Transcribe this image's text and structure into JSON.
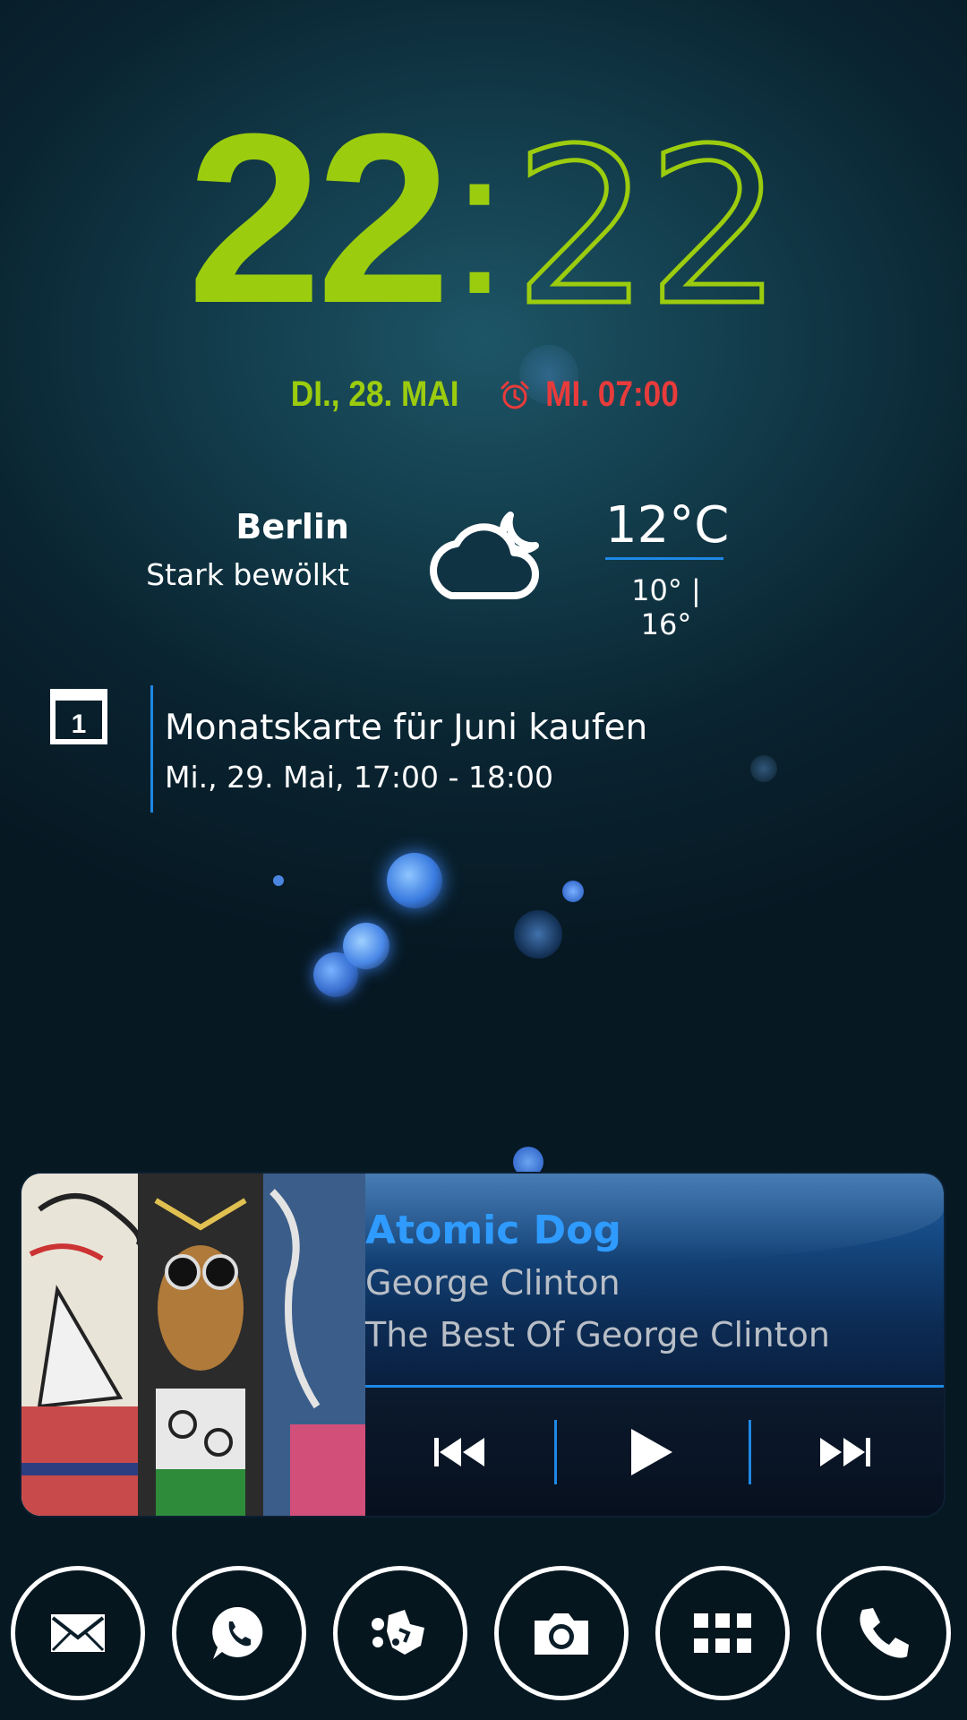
{
  "clock": {
    "hours": "22",
    "separator": ":",
    "minutes": "22"
  },
  "date": {
    "text": "DI., 28. MAI",
    "alarm": "MI. 07:00",
    "alarm_icon": "alarm-clock-icon"
  },
  "weather": {
    "city": "Berlin",
    "condition": "Stark bewölkt",
    "temperature": "12°C",
    "low_high": "10° | 16°",
    "icon": "cloudy-moon-icon"
  },
  "calendar": {
    "icon_label": "1",
    "event_title": "Monatskarte für Juni kaufen",
    "event_time": "Mi., 29. Mai, 17:00 - 18:00"
  },
  "music": {
    "title": "Atomic Dog",
    "artist": "George Clinton",
    "album": "The Best Of George Clinton",
    "controls": [
      "previous-icon",
      "play-icon",
      "next-icon"
    ]
  },
  "dock": {
    "apps": [
      "email-icon",
      "whatsapp-icon",
      "puzzle-icon",
      "camera-icon",
      "app-drawer-icon",
      "phone-icon"
    ]
  },
  "colors": {
    "clock": "#9ccc0e",
    "alarm": "#e83b3b",
    "accent": "#1e88e5",
    "song": "#2f9bff"
  }
}
